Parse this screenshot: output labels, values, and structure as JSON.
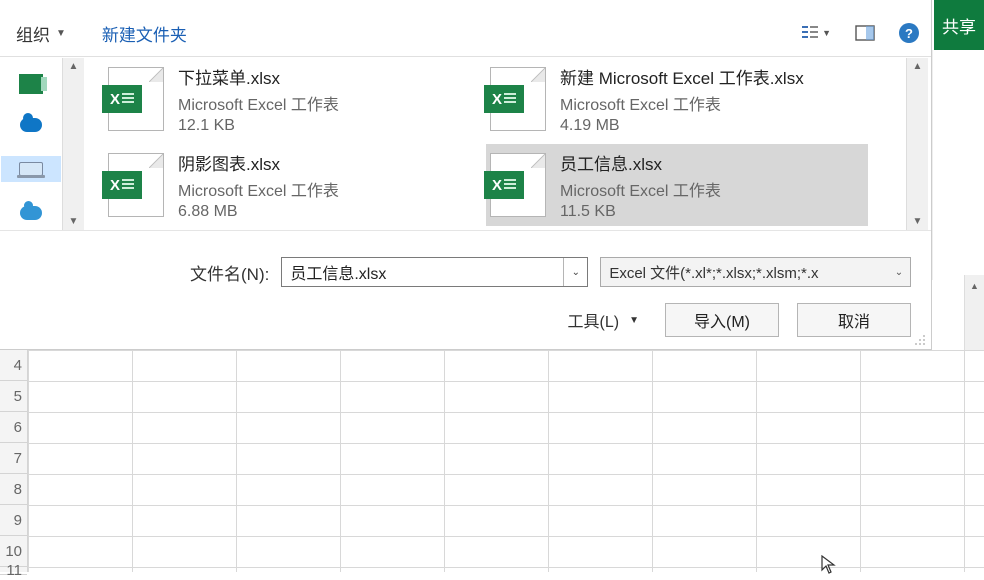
{
  "share_label": "共享",
  "toolbar": {
    "organize_label": "组织",
    "new_folder_label": "新建文件夹"
  },
  "files": [
    {
      "name": "下拉菜单.xlsx",
      "type": "Microsoft Excel 工作表",
      "size": "12.1 KB"
    },
    {
      "name": "新建 Microsoft Excel 工作表.xlsx",
      "type": "Microsoft Excel 工作表",
      "size": "4.19 MB"
    },
    {
      "name": "阴影图表.xlsx",
      "type": "Microsoft Excel 工作表",
      "size": "6.88 MB"
    },
    {
      "name": "员工信息.xlsx",
      "type": "Microsoft Excel 工作表",
      "size": "11.5 KB"
    }
  ],
  "filename": {
    "label": "文件名(N):",
    "value": "员工信息.xlsx"
  },
  "filter": {
    "text": "Excel 文件(*.xl*;*.xlsx;*.xlsm;*.x"
  },
  "tools_label": "工具(L)",
  "buttons": {
    "import": "导入(M)",
    "cancel": "取消"
  },
  "rows": [
    "4",
    "5",
    "6",
    "7",
    "8",
    "9",
    "10",
    "11"
  ]
}
